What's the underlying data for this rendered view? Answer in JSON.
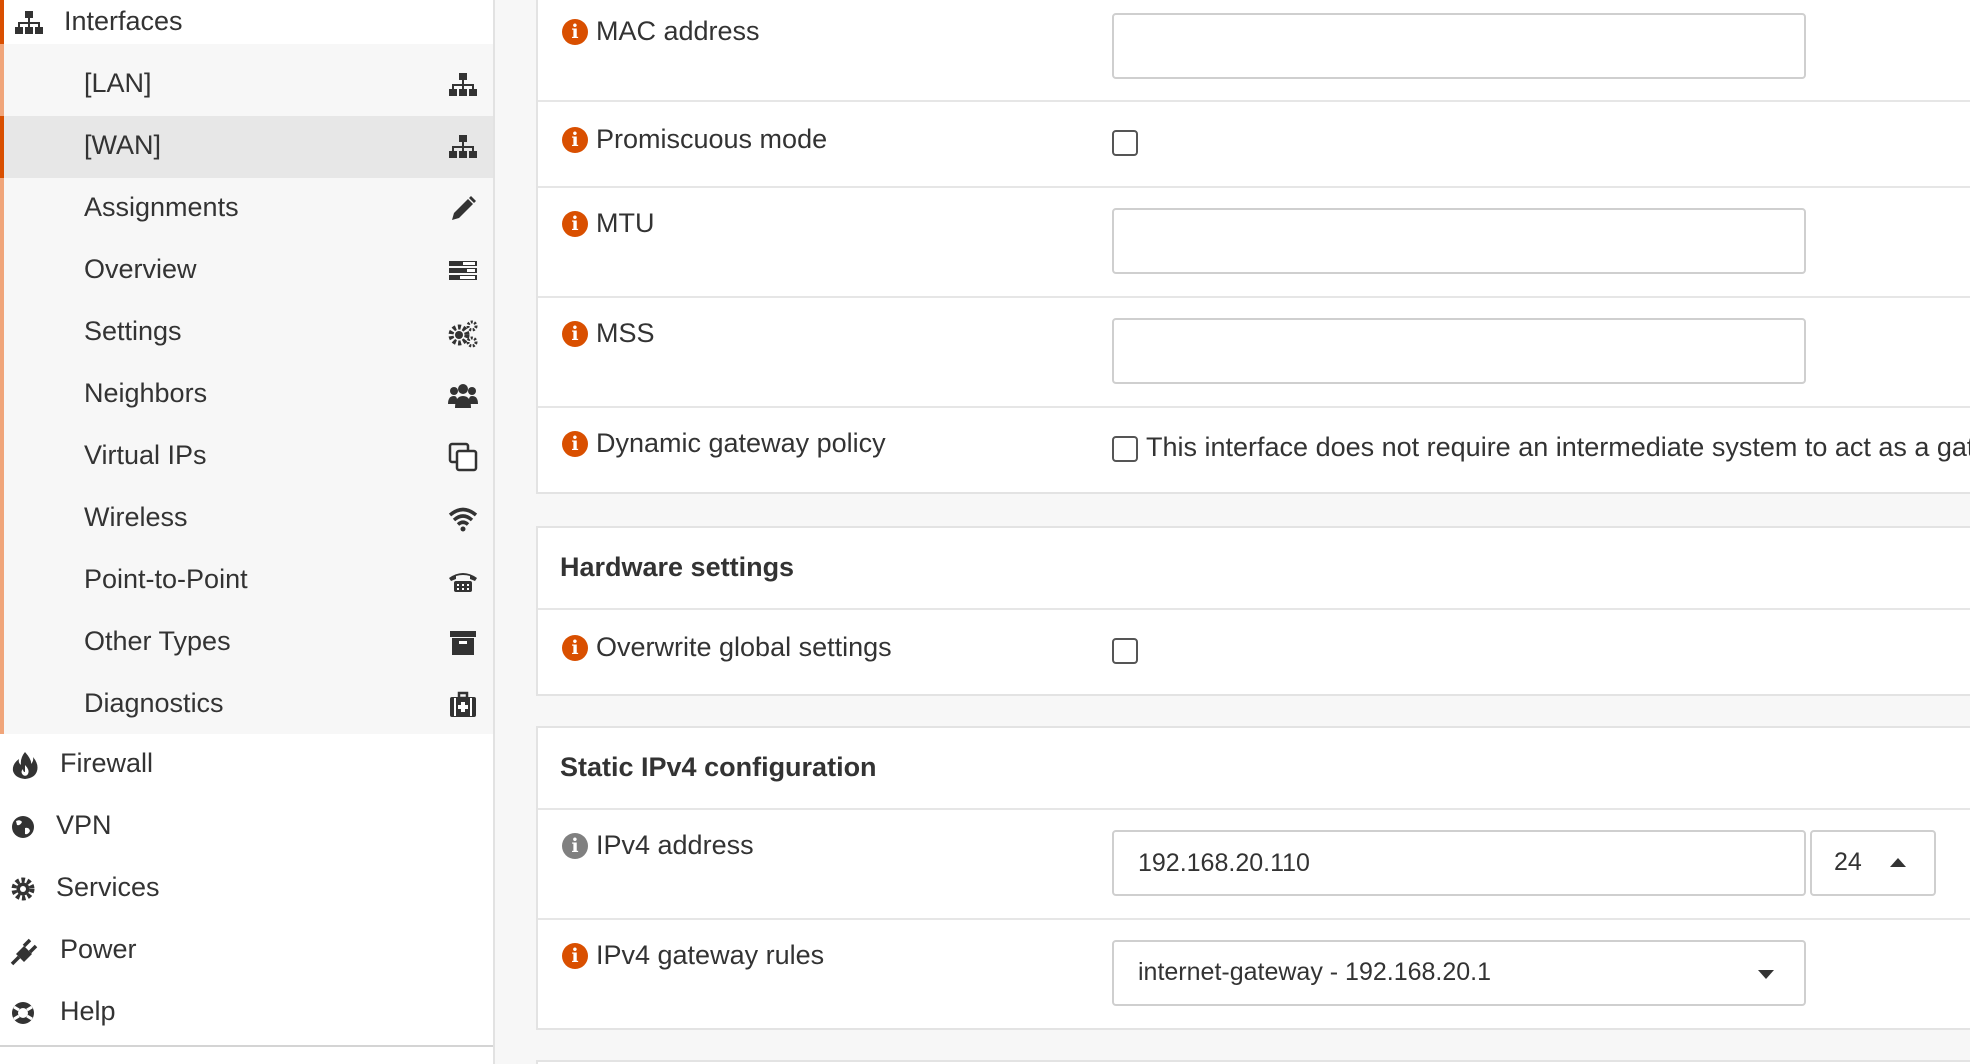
{
  "sidebar": {
    "interfaces": {
      "label": "Interfaces",
      "icon": "sitemap-icon"
    },
    "submenu": [
      {
        "label": "[LAN]",
        "icon": "sitemap-icon"
      },
      {
        "label": "[WAN]",
        "icon": "sitemap-icon",
        "active": true
      },
      {
        "label": "Assignments",
        "icon": "pencil-icon"
      },
      {
        "label": "Overview",
        "icon": "tasks-icon"
      },
      {
        "label": "Settings",
        "icon": "cogs-icon"
      },
      {
        "label": "Neighbors",
        "icon": "users-icon"
      },
      {
        "label": "Virtual IPs",
        "icon": "clone-icon"
      },
      {
        "label": "Wireless",
        "icon": "wifi-icon"
      },
      {
        "label": "Point-to-Point",
        "icon": "phone-icon"
      },
      {
        "label": "Other Types",
        "icon": "archive-icon"
      },
      {
        "label": "Diagnostics",
        "icon": "medkit-icon"
      }
    ],
    "items": [
      {
        "label": "Firewall",
        "icon": "fire-icon"
      },
      {
        "label": "VPN",
        "icon": "globe-icon"
      },
      {
        "label": "Services",
        "icon": "cog-icon"
      },
      {
        "label": "Power",
        "icon": "plug-icon"
      },
      {
        "label": "Help",
        "icon": "lifebuoy-icon"
      }
    ]
  },
  "general": {
    "mac_label": "MAC address",
    "mac_value": "",
    "promisc_label": "Promiscuous mode",
    "mtu_label": "MTU",
    "mtu_value": "",
    "mss_label": "MSS",
    "mss_value": "",
    "dyngw_label": "Dynamic gateway policy",
    "dyngw_text": "This interface does not require an intermediate system to act as a gateway"
  },
  "hardware": {
    "title": "Hardware settings",
    "overwrite_label": "Overwrite global settings"
  },
  "ipv4": {
    "title": "Static IPv4 configuration",
    "address_label": "IPv4 address",
    "address_value": "192.168.20.110",
    "cidr_value": "24",
    "gateway_label": "IPv4 gateway rules",
    "gateway_value": "internet-gateway - 192.168.20.1"
  },
  "colors": {
    "accent": "#d94f00",
    "info_grey": "#808080"
  }
}
